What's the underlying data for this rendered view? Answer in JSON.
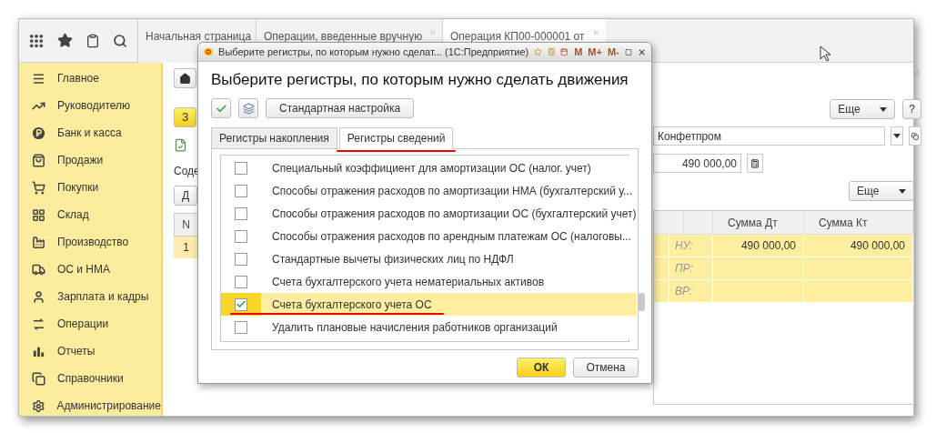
{
  "top_bar": {
    "tabs": [
      {
        "label": "Начальная страница",
        "selected": false,
        "closable": false
      },
      {
        "label": "Операции, введенные вручную",
        "selected": false,
        "closable": true
      },
      {
        "label": "Операция КП00-000001 от",
        "selected": true,
        "closable": true
      }
    ]
  },
  "sidebar": {
    "items": [
      {
        "label": "Главное"
      },
      {
        "label": "Руководителю"
      },
      {
        "label": "Банк и касса"
      },
      {
        "label": "Продажи"
      },
      {
        "label": "Покупки"
      },
      {
        "label": "Склад"
      },
      {
        "label": "Производство"
      },
      {
        "label": "ОС и НМА"
      },
      {
        "label": "Зарплата и кадры"
      },
      {
        "label": "Операции"
      },
      {
        "label": "Отчеты"
      },
      {
        "label": "Справочники"
      },
      {
        "label": "Администрирование"
      }
    ]
  },
  "form": {
    "left": {
      "create_button": "З",
      "content_label": "Соде",
      "add_button": "Д",
      "table_header": "N",
      "row_number": "1"
    },
    "right": {
      "more_button": "Еще",
      "help_button": "?",
      "organization": "Конфетпром",
      "amount": "490 000,00",
      "table_more_button": "Еще",
      "columns": [
        "Сумма Дт",
        "Сумма Кт"
      ],
      "rows": [
        {
          "type": "НУ:",
          "debit": "490 000,00",
          "credit": "490 000,00"
        },
        {
          "type": "ПР:"
        },
        {
          "type": "ВР:"
        }
      ]
    }
  },
  "dialog": {
    "window_title": "Выберите регистры, по которым нужно сделат...  (1С:Предприятие)",
    "memory_buttons": [
      "M",
      "M+",
      "M-"
    ],
    "heading": "Выберите регистры, по которым нужно сделать движения",
    "settings_button": "Стандартная настройка",
    "tabs": [
      {
        "label": "Регистры накопления",
        "selected": false,
        "underlined": false
      },
      {
        "label": "Регистры сведений",
        "selected": true,
        "underlined": true
      }
    ],
    "registers": [
      {
        "label": "Специальный коэффициент для амортизации ОС (налог. учет)",
        "checked": false,
        "selected": false,
        "underlined": false
      },
      {
        "label": "Способы отражения расходов по амортизации НМА (бухгалтерский у...",
        "checked": false,
        "selected": false,
        "underlined": false
      },
      {
        "label": "Способы отражения расходов по амортизации ОС (бухгалтерский учет)",
        "checked": false,
        "selected": false,
        "underlined": false
      },
      {
        "label": "Способы отражения расходов по арендным платежам ОС (налоговы...",
        "checked": false,
        "selected": false,
        "underlined": false
      },
      {
        "label": "Стандартные вычеты физических лиц по НДФЛ",
        "checked": false,
        "selected": false,
        "underlined": false
      },
      {
        "label": "Счета бухгалтерского учета нематериальных активов",
        "checked": false,
        "selected": false,
        "underlined": false
      },
      {
        "label": "Счета бухгалтерского учета ОС",
        "checked": true,
        "selected": true,
        "underlined": true
      },
      {
        "label": "Удалить плановые начисления работников организаций",
        "checked": false,
        "selected": false,
        "underlined": false
      }
    ],
    "buttons": [
      {
        "label": "ОК",
        "kind": "primary"
      },
      {
        "label": "Отмена",
        "kind": "default"
      }
    ]
  }
}
